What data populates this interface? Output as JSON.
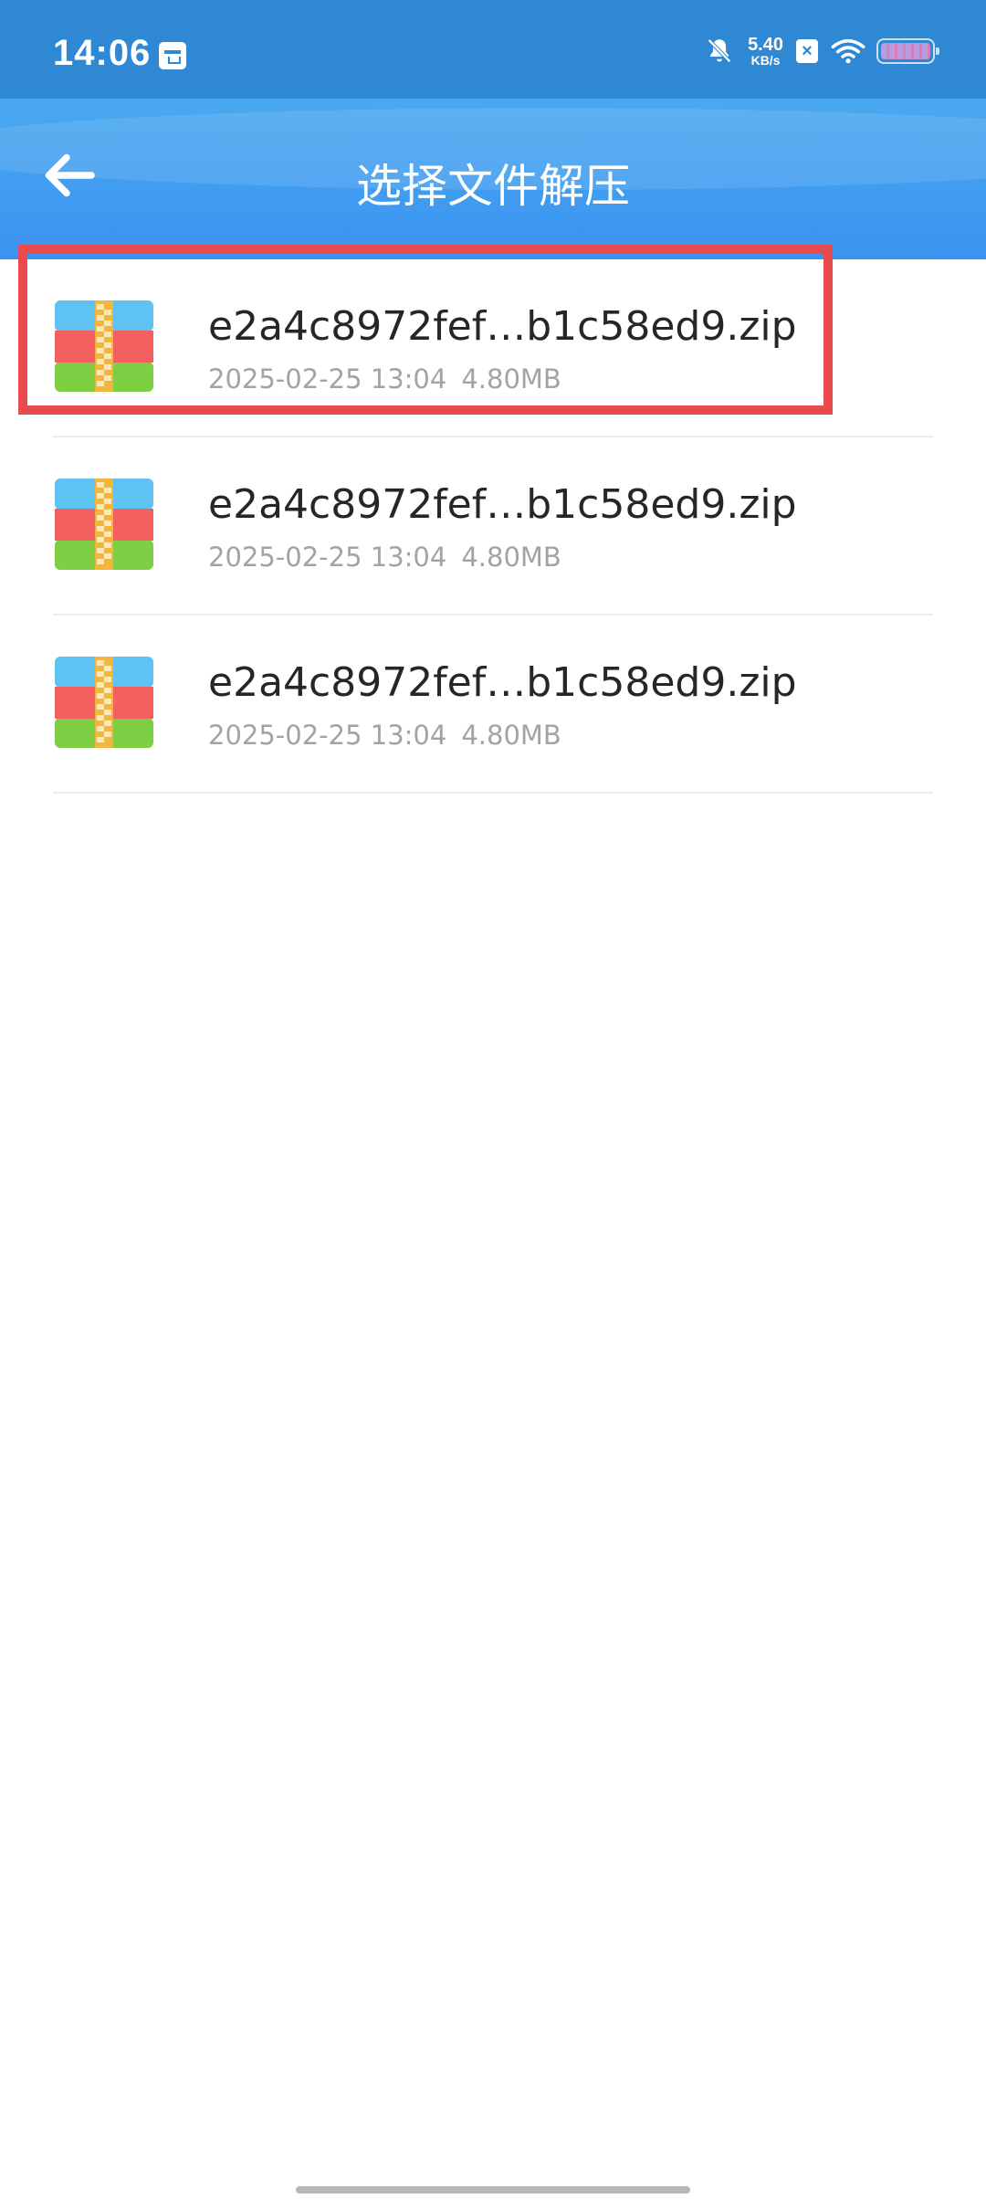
{
  "status_bar": {
    "time": "14:06",
    "net_speed_value": "5.40",
    "net_speed_unit": "KB/s",
    "icons": [
      "calendar-icon",
      "mute-bell-icon",
      "close-box-icon",
      "wifi-icon",
      "battery-icon"
    ]
  },
  "header": {
    "title": "选择文件解压",
    "back_icon": "arrow-left-icon"
  },
  "files": [
    {
      "name": "e2a4c8972fef…b1c58ed9.zip",
      "date": "2025-02-25 13:04",
      "size": "4.80MB"
    },
    {
      "name": "e2a4c8972fef…b1c58ed9.zip",
      "date": "2025-02-25 13:04",
      "size": "4.80MB"
    },
    {
      "name": "e2a4c8972fef…b1c58ed9.zip",
      "date": "2025-02-25 13:04",
      "size": "4.80MB"
    }
  ],
  "colors": {
    "status_bar": "#2f88d3",
    "app_bar": "#3a93f0",
    "highlight": "#e84a4e",
    "zip_top": "#5ec2f2",
    "zip_middle": "#f2615f",
    "zip_bottom": "#7fcf45",
    "zip_zipper": "#f0b640"
  }
}
